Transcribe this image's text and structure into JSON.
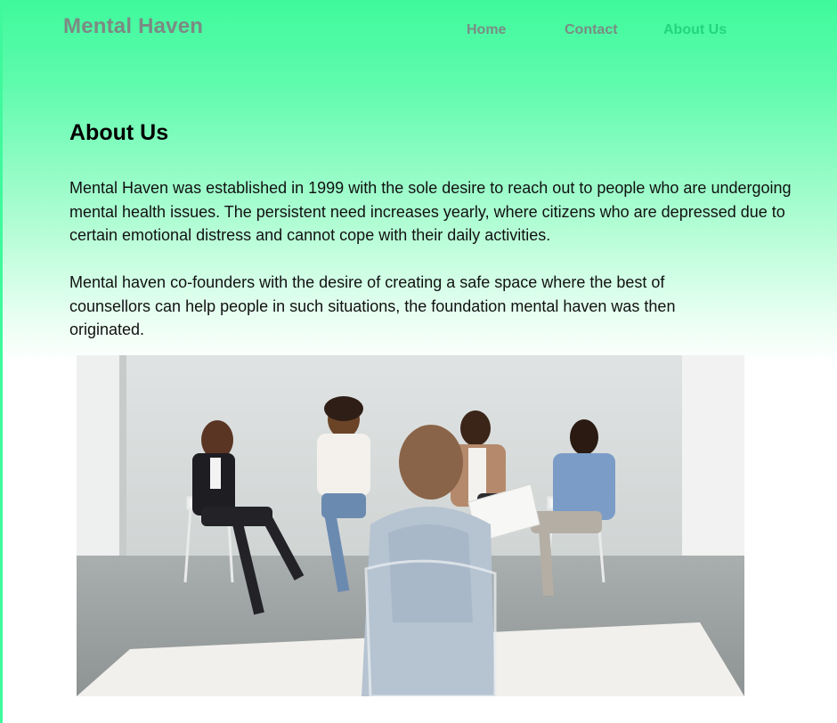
{
  "header": {
    "brand": "Mental Haven",
    "nav": [
      {
        "label": "Home",
        "active": false
      },
      {
        "label": "Contact",
        "active": false
      },
      {
        "label": "About Us",
        "active": true
      }
    ]
  },
  "main": {
    "title": "About Us",
    "paragraphs": [
      "Mental Haven was established in 1999 with the sole desire to reach out to people who are undergoing mental health issues. The persistent need increases yearly, where citizens who are depressed due to certain emotional distress and cannot cope with their daily activities.",
      "Mental haven co-founders with the desire of creating a safe space where the best of counsellors can help people in such situations, the foundation mental haven was then originated."
    ]
  },
  "colors": {
    "accent": "#3ff99c",
    "active_nav": "#22d67e",
    "muted_nav": "#7a8c84"
  }
}
